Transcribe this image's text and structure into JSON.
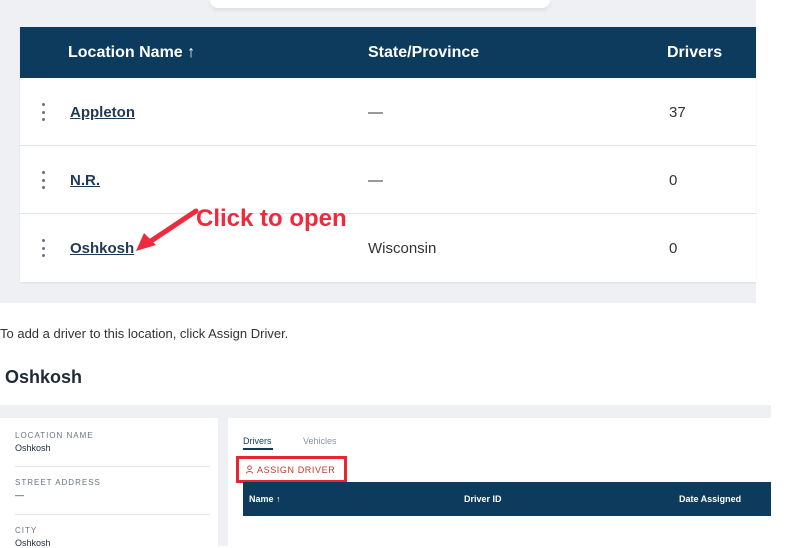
{
  "locations_table": {
    "columns": {
      "name": "Location Name ↑",
      "state": "State/Province",
      "drivers": "Drivers"
    },
    "rows": [
      {
        "name": "Appleton",
        "state": "—",
        "drivers": "37"
      },
      {
        "name": "N.R.",
        "state": "—",
        "drivers": "0"
      },
      {
        "name": "Oshkosh",
        "state": "Wisconsin",
        "drivers": "0"
      }
    ]
  },
  "annotation": {
    "text": "Click to open",
    "color": "#ee2a3c"
  },
  "instruction": "To add a driver to this location, click Assign Driver.",
  "detail": {
    "title": "Oshkosh",
    "fields": [
      {
        "label": "LOCATION NAME",
        "value": "Oshkosh"
      },
      {
        "label": "STREET ADDRESS",
        "value": "—"
      },
      {
        "label": "CITY",
        "value": "Oshkosh"
      }
    ],
    "tabs": {
      "drivers": "Drivers",
      "vehicles": "Vehicles"
    },
    "assign_button": "ASSIGN DRIVER",
    "drivers_table": {
      "columns": {
        "name": "Name ↑",
        "driver_id": "Driver ID",
        "date_assigned": "Date Assigned"
      }
    }
  },
  "colors": {
    "header_navy": "#0d3b5e",
    "highlight_red": "#e6252f",
    "panel_bg": "#eef0f3"
  }
}
